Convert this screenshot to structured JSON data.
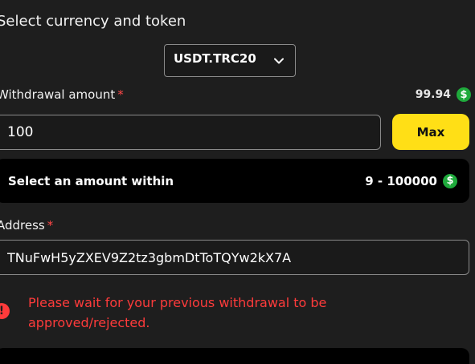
{
  "currency_section": {
    "title": "Select currency and token",
    "selected_token": "USDT.TRC20"
  },
  "withdrawal": {
    "label": "Withdrawal amount",
    "required_marker": "*",
    "balance": "99.94",
    "amount_value": "100",
    "max_label": "Max"
  },
  "range": {
    "label": "Select an amount within",
    "value": "9 - 100000"
  },
  "address": {
    "label": "Address",
    "required_marker": "*",
    "value": "TNuFwH5yZXEV9Z2tz3gbmDtToTQYw2kX7A"
  },
  "error": {
    "message": "Please wait for your previous withdrawal to be approved/rejected."
  },
  "icons": {
    "coin": "dollar-coin-icon",
    "chevron": "chevron-down-icon",
    "error": "exclamation-icon"
  },
  "colors": {
    "background": "#1e1e1e",
    "accent": "#ffdf16",
    "error": "#ff3b3b",
    "coin": "#1faa3c"
  }
}
